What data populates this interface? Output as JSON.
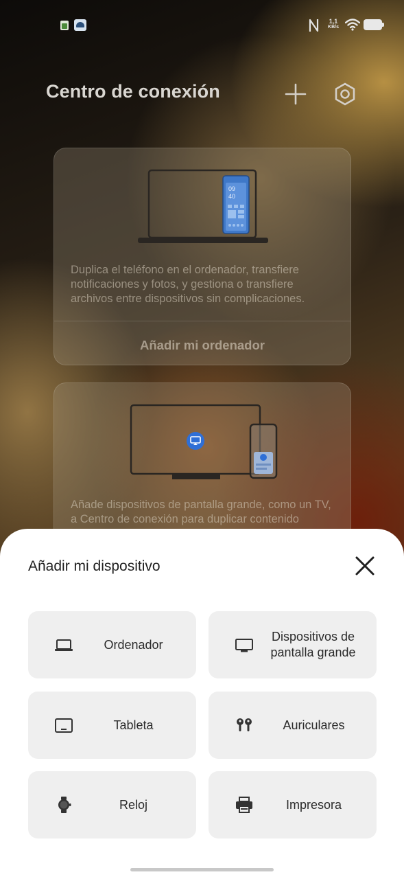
{
  "status_bar": {
    "speed_value": "1,1",
    "speed_unit": "KB/s",
    "icons": [
      "notification-app-icon",
      "notification-photo-icon",
      "nfc-icon",
      "wifi-icon",
      "battery-icon"
    ]
  },
  "header": {
    "title": "Centro de conexión",
    "add_icon": "plus-icon",
    "settings_icon": "settings-icon"
  },
  "cards": [
    {
      "description": "Duplica el teléfono en el ordenador, transfiere notificaciones y fotos, y gestiona o transfiere archivos entre dispositivos sin complicaciones.",
      "action": "Añadir mi ordenador",
      "illustration_clock": "09\n40"
    },
    {
      "description": "Añade dispositivos de pantalla grande, como un TV, a Centro de conexión para duplicar contenido"
    }
  ],
  "sheet": {
    "title": "Añadir mi dispositivo",
    "close_icon": "close-icon",
    "options": [
      {
        "label": "Ordenador",
        "icon": "laptop-icon"
      },
      {
        "label": "Dispositivos de pantalla grande",
        "icon": "monitor-icon"
      },
      {
        "label": "Tableta",
        "icon": "tablet-icon"
      },
      {
        "label": "Auriculares",
        "icon": "earbuds-icon"
      },
      {
        "label": "Reloj",
        "icon": "watch-icon"
      },
      {
        "label": "Impresora",
        "icon": "printer-icon"
      }
    ]
  },
  "colors": {
    "sheet_bg": "#ffffff",
    "tile_bg": "#efefef",
    "accent_blue": "#2f6fd6"
  }
}
